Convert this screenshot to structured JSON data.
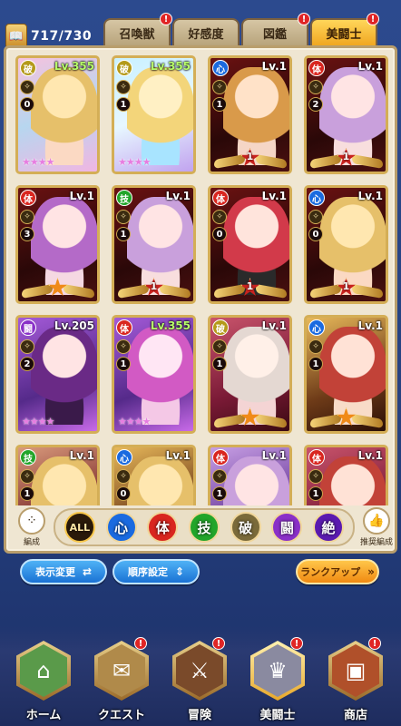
{
  "header": {
    "count": "717/730",
    "tabs": [
      {
        "label": "召喚獣",
        "badge": "!",
        "active": false
      },
      {
        "label": "好感度",
        "badge": "",
        "active": false
      },
      {
        "label": "図鑑",
        "badge": "!",
        "active": false
      },
      {
        "label": "美闘士",
        "badge": "!",
        "active": true
      }
    ]
  },
  "cards": [
    {
      "attr": "破",
      "lv": "Lv.355",
      "max": true,
      "num": "0",
      "stars": "★★★★",
      "bg": "pink",
      "hair": "blonde",
      "rank": ""
    },
    {
      "attr": "破",
      "lv": "Lv.355",
      "max": true,
      "num": "1",
      "stars": "★★★★",
      "bg": "cyan",
      "hair": "cyan",
      "rank": ""
    },
    {
      "attr": "心",
      "lv": "Lv.1",
      "max": false,
      "num": "1",
      "stars": "",
      "bg": "dark",
      "hair": "orange",
      "rank": "1"
    },
    {
      "attr": "体",
      "lv": "Lv.1",
      "max": false,
      "num": "2",
      "stars": "",
      "bg": "dark",
      "hair": "lilac",
      "rank": "1"
    },
    {
      "attr": "体",
      "lv": "Lv.1",
      "max": false,
      "num": "3",
      "stars": "",
      "bg": "dark",
      "hair": "violet",
      "rank": ""
    },
    {
      "attr": "技",
      "lv": "Lv.1",
      "max": false,
      "num": "1",
      "stars": "",
      "bg": "dark",
      "hair": "lilac",
      "rank": "1"
    },
    {
      "attr": "体",
      "lv": "Lv.1",
      "max": false,
      "num": "0",
      "stars": "",
      "bg": "dark",
      "hair": "red",
      "rank": "1"
    },
    {
      "attr": "心",
      "lv": "Lv.1",
      "max": false,
      "num": "0",
      "stars": "",
      "bg": "dark",
      "hair": "blonde",
      "rank": "1"
    },
    {
      "attr": "闘",
      "lv": "Lv.205",
      "max": false,
      "num": "2",
      "stars": "★★★★",
      "bg": "purple",
      "hair": "dark",
      "rank": ""
    },
    {
      "attr": "体",
      "lv": "Lv.355",
      "max": true,
      "num": "1",
      "stars": "★★★★",
      "bg": "purple",
      "hair": "magenta",
      "rank": ""
    },
    {
      "attr": "破",
      "lv": "Lv.1",
      "max": false,
      "num": "1",
      "stars": "",
      "bg": "red",
      "hair": "silver",
      "rank": ""
    },
    {
      "attr": "心",
      "lv": "Lv.1",
      "max": false,
      "num": "1",
      "stars": "",
      "bg": "gold",
      "hair": "crimson",
      "rank": ""
    },
    {
      "attr": "技",
      "lv": "Lv.1",
      "max": false,
      "num": "1",
      "stars": "",
      "bg": "wine",
      "hair": "blonde",
      "rank": ""
    },
    {
      "attr": "心",
      "lv": "Lv.1",
      "max": false,
      "num": "0",
      "stars": "",
      "bg": "gold",
      "hair": "blonde",
      "rank": ""
    },
    {
      "attr": "体",
      "lv": "Lv.1",
      "max": false,
      "num": "1",
      "stars": "",
      "bg": "lav",
      "hair": "lilac",
      "rank": ""
    },
    {
      "attr": "体",
      "lv": "Lv.1",
      "max": false,
      "num": "1",
      "stars": "",
      "bg": "red",
      "hair": "crimson",
      "rank": ""
    }
  ],
  "attr_colors": {
    "心": "#1a6ae0",
    "体": "#d9261f",
    "技": "#22a52a",
    "破": "#b49a1a",
    "闘": "#8a30c8",
    "絶": "#7a1ad0"
  },
  "filters": {
    "left_label": "編成",
    "right_label": "推奨編成",
    "items": [
      {
        "label": "ALL",
        "color": "#2a1a0a"
      },
      {
        "label": "心",
        "color": "#1a6ae0"
      },
      {
        "label": "体",
        "color": "#d9261f"
      },
      {
        "label": "技",
        "color": "#22a52a"
      },
      {
        "label": "破",
        "color": "#7a6a3a"
      },
      {
        "label": "闘",
        "color": "#8a30c8"
      },
      {
        "label": "絶",
        "color": "#5a1ab0"
      }
    ]
  },
  "controls": {
    "display_change": "表示変更",
    "display_change_icon": "⇄",
    "order_setting": "順序設定",
    "order_setting_icon": "⇕",
    "rank_up": "ランクアップ",
    "rank_up_icon": "»"
  },
  "nav": [
    {
      "label": "ホーム",
      "icon": "⌂",
      "badge": "",
      "active": false,
      "color": "#5a9a4a"
    },
    {
      "label": "クエスト",
      "icon": "✉",
      "badge": "!",
      "active": false,
      "color": "#b08a4a"
    },
    {
      "label": "冒険",
      "icon": "⚔",
      "badge": "!",
      "active": false,
      "color": "#7a4a2a"
    },
    {
      "label": "美闘士",
      "icon": "♛",
      "badge": "!",
      "active": true,
      "color": "#8a8aa0"
    },
    {
      "label": "商店",
      "icon": "▣",
      "badge": "!",
      "active": false,
      "color": "#b0502a"
    }
  ]
}
